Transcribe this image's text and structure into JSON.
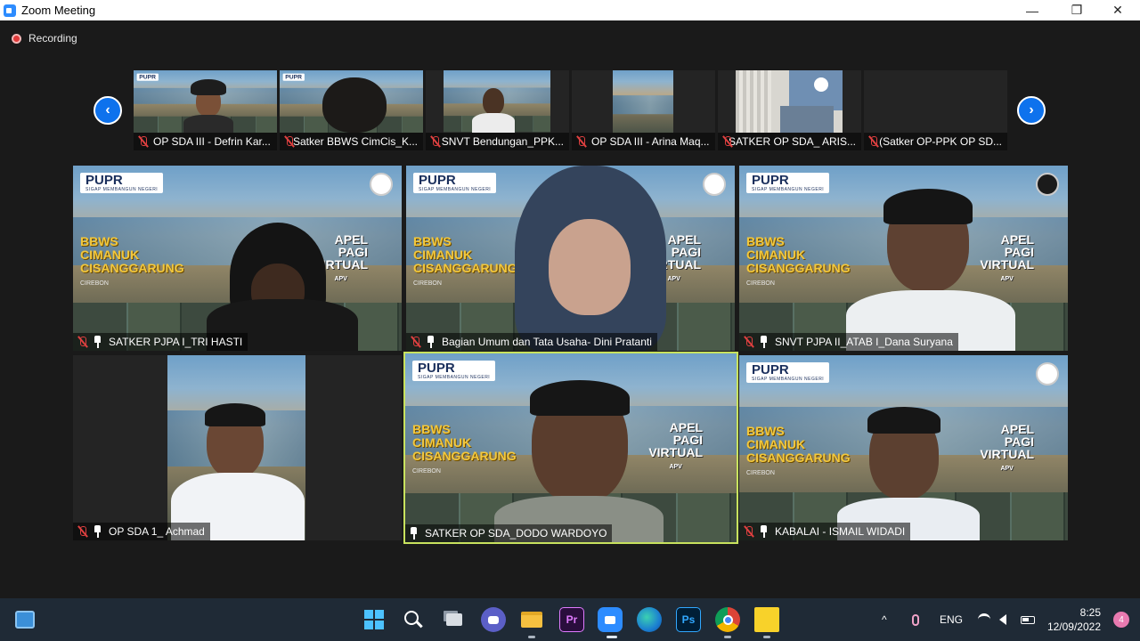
{
  "window": {
    "title": "Zoom Meeting",
    "minimize": "—",
    "maximize": "❐",
    "close": "✕"
  },
  "recording": {
    "label": "Recording"
  },
  "thumbnails": [
    {
      "name": "OP SDA III - Defrin Kar...",
      "muted": true
    },
    {
      "name": "Satker BBWS CimCis_K...",
      "muted": true
    },
    {
      "name": "SNVT Bendungan_PPK...",
      "muted": true
    },
    {
      "name": "OP SDA III - Arina Maq...",
      "muted": true
    },
    {
      "name": "SATKER OP SDA_ ARIS...",
      "muted": true
    },
    {
      "name": "(Satker OP-PPK OP SD...",
      "muted": true
    }
  ],
  "nav": {
    "prev": "‹",
    "next": "›"
  },
  "background": {
    "logo": "PUPR",
    "logo_sub": "SIGAP MEMBANGUN NEGERI",
    "org_line1": "BBWS",
    "org_line2": "CIMANUK",
    "org_line3": "CISANGGARUNG",
    "city": "CIREBON",
    "event_line1": "APEL",
    "event_line2": "PAGI",
    "event_line3": "VIRTUAL",
    "event_abbr": "APV"
  },
  "tiles": [
    {
      "name": "SATKER PJPA I_TRI HASTI",
      "muted": true,
      "pinned": true,
      "active": false
    },
    {
      "name": "Bagian Umum dan Tata Usaha- Dini Pratanti",
      "muted": true,
      "pinned": true,
      "active": false
    },
    {
      "name": "SNVT PJPA II_ATAB I_Dana Suryana",
      "muted": true,
      "pinned": true,
      "active": false
    },
    {
      "name": "OP SDA 1_ Achmad",
      "muted": true,
      "pinned": true,
      "active": false
    },
    {
      "name": "SATKER OP SDA_DODO WARDOYO",
      "muted": false,
      "pinned": true,
      "active": true
    },
    {
      "name": "KABALAI - ISMAIL WIDADI",
      "muted": true,
      "pinned": true,
      "active": false
    }
  ],
  "taskbar": {
    "apps": [
      "start-icon",
      "search-icon",
      "task-view-icon",
      "teams-chat-icon",
      "file-explorer-icon",
      "premiere-icon",
      "zoom-icon",
      "edge-icon",
      "photoshop-icon",
      "chrome-icon",
      "sticky-notes-icon"
    ],
    "premiere_label": "Pr",
    "photoshop_label": "Ps",
    "tray_caret": "^",
    "language": "ENG",
    "time": "8:25",
    "date": "12/09/2022",
    "notifications": "4"
  },
  "colors": {
    "active_speaker_border": "#c8e25e",
    "muted_red": "#e04040",
    "nav_blue": "#0e72ed",
    "taskbar": "#1f2a36"
  }
}
